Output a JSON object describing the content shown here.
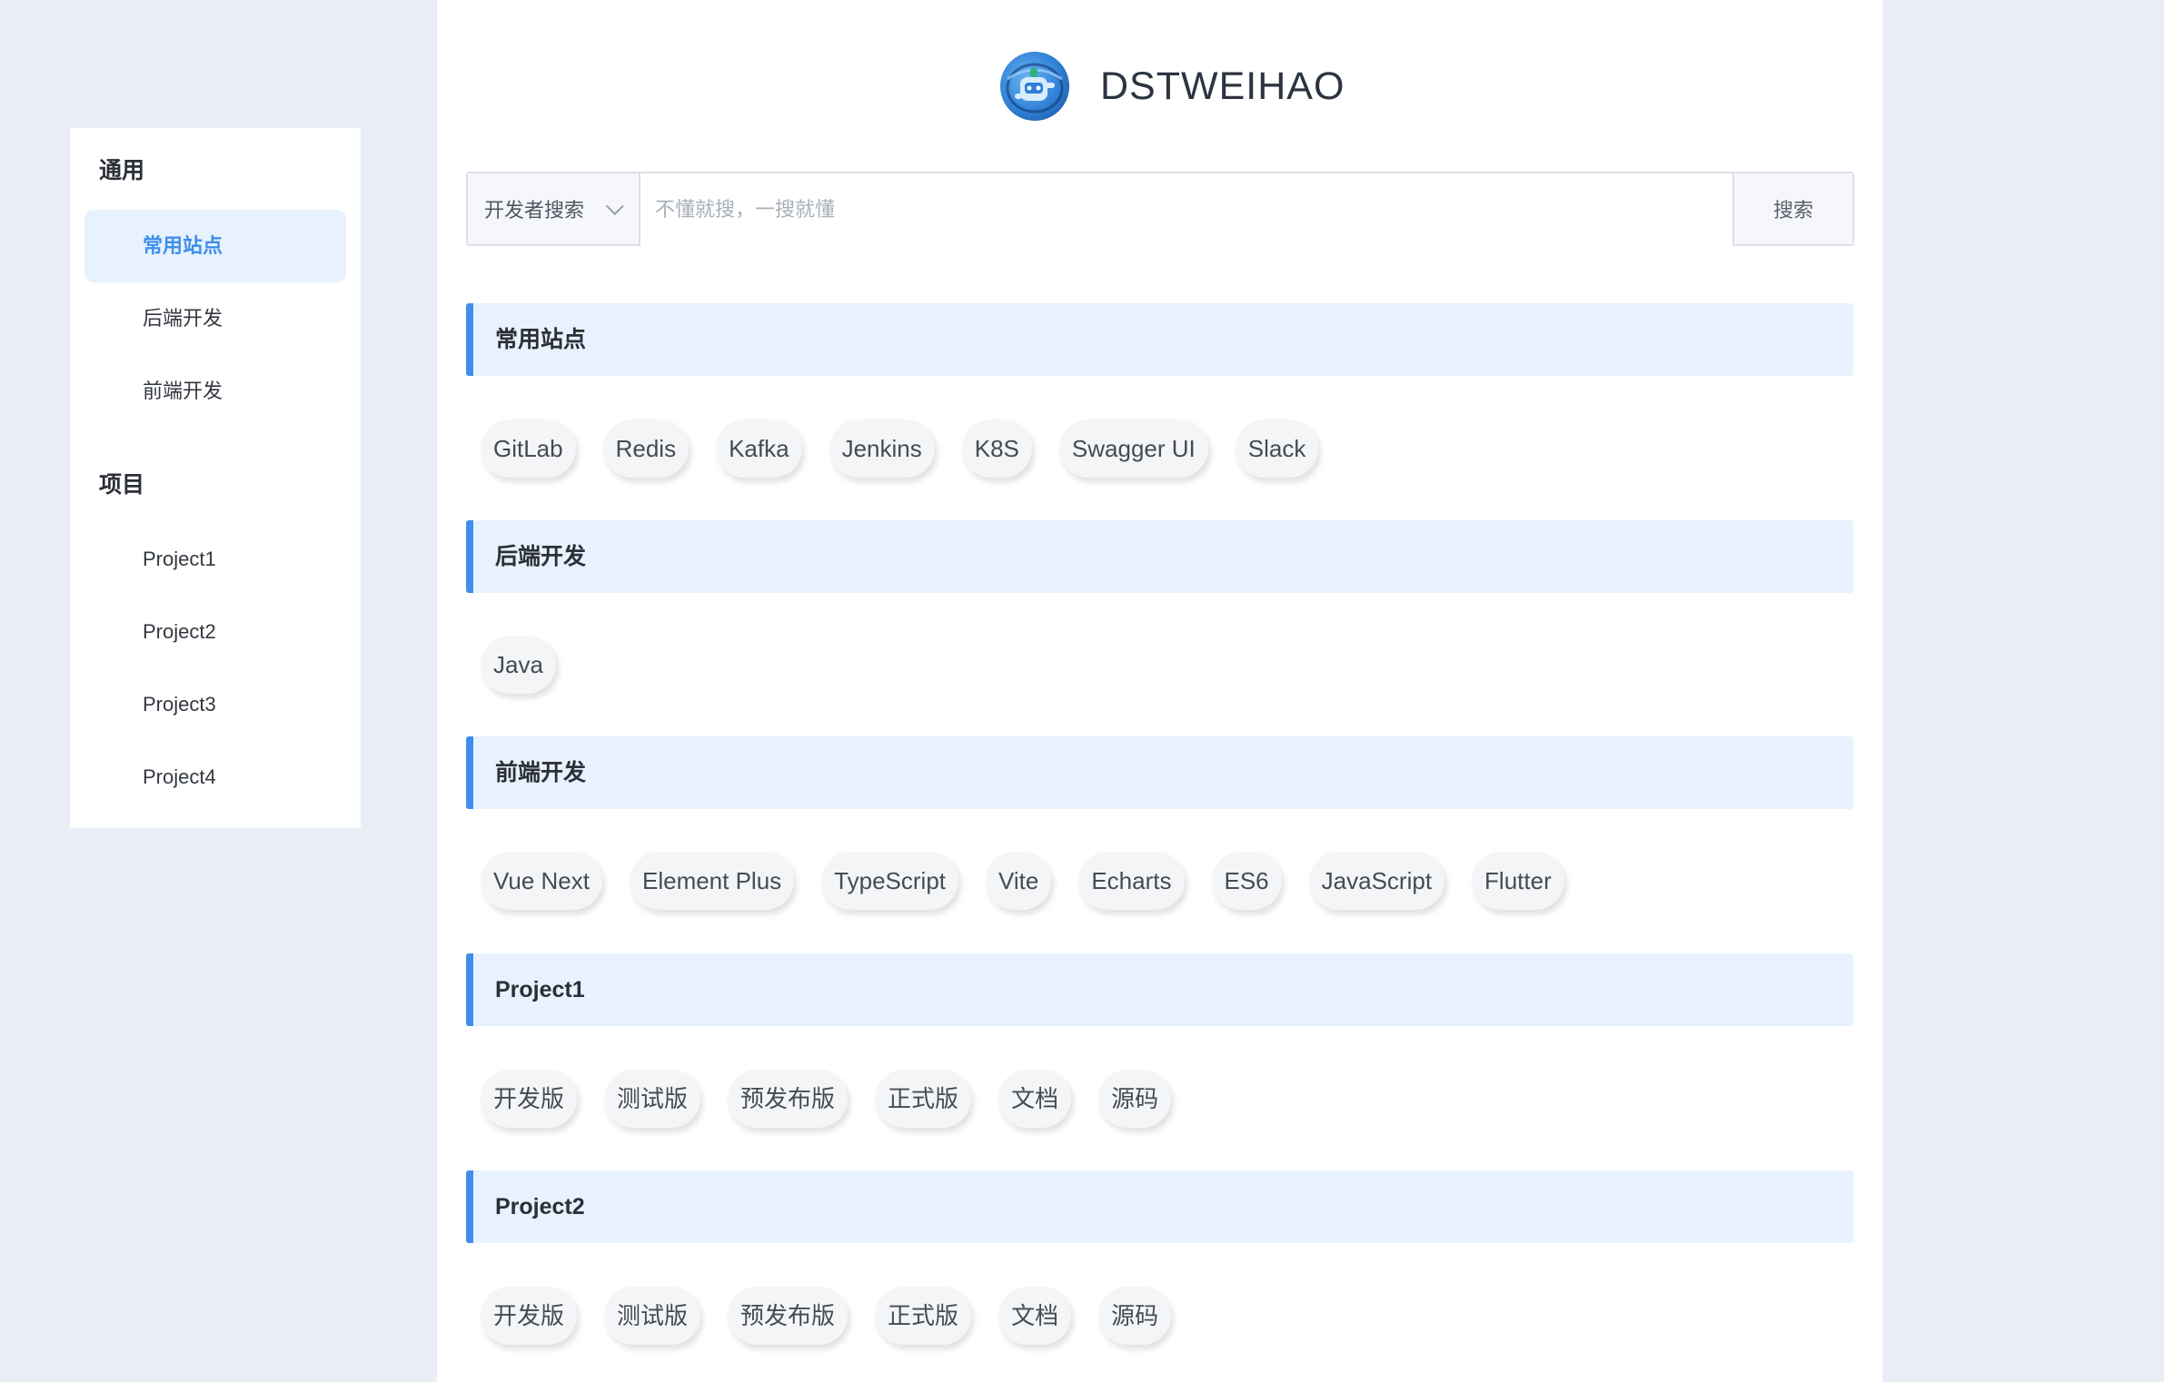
{
  "sidebar": {
    "groups": [
      {
        "title": "通用",
        "items": [
          {
            "label": "常用站点",
            "active": true
          },
          {
            "label": "后端开发",
            "active": false
          },
          {
            "label": "前端开发",
            "active": false
          }
        ]
      },
      {
        "title": "项目",
        "items": [
          {
            "label": "Project1",
            "active": false
          },
          {
            "label": "Project2",
            "active": false
          },
          {
            "label": "Project3",
            "active": false
          },
          {
            "label": "Project4",
            "active": false
          }
        ]
      }
    ]
  },
  "header": {
    "title": "DSTWEIHAO",
    "logo_icon": "robot-globe-logo-icon"
  },
  "search": {
    "engine": "开发者搜索",
    "placeholder": "不懂就搜，一搜就懂",
    "button": "搜索"
  },
  "sections": [
    {
      "title": "常用站点",
      "links": [
        "GitLab",
        "Redis",
        "Kafka",
        "Jenkins",
        "K8S",
        "Swagger UI",
        "Slack"
      ]
    },
    {
      "title": "后端开发",
      "links": [
        "Java"
      ]
    },
    {
      "title": "前端开发",
      "links": [
        "Vue Next",
        "Element Plus",
        "TypeScript",
        "Vite",
        "Echarts",
        "ES6",
        "JavaScript",
        "Flutter"
      ]
    },
    {
      "title": "Project1",
      "links": [
        "开发版",
        "测试版",
        "预发布版",
        "正式版",
        "文档",
        "源码"
      ]
    },
    {
      "title": "Project2",
      "links": [
        "开发版",
        "测试版",
        "预发布版",
        "正式版",
        "文档",
        "源码"
      ]
    }
  ],
  "colors": {
    "accent": "#3d8fea",
    "section_bg": "#e8f1fe",
    "page_bg": "#e9edf5"
  }
}
